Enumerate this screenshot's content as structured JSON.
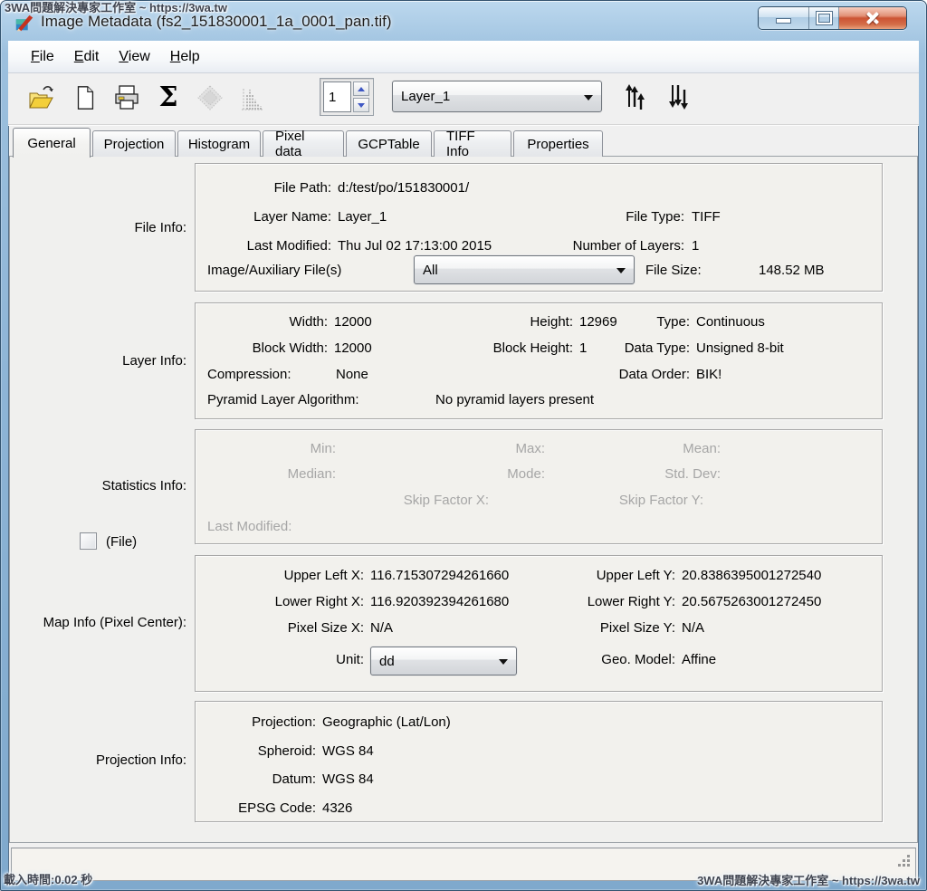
{
  "colors": {
    "frame_blue": "#8fb5d6",
    "close_button_red": "#cc5334",
    "dialog_bg": "#f0f0f0",
    "disabled_text": "#a6a6a6",
    "group_border": "#a7a7a7"
  },
  "watermarks": {
    "top_left": "3WA問題解決專家工作室 ~ https://3wa.tw",
    "bottom_left": "載入時間:0.02 秒",
    "bottom_right": "3WA問題解決專家工作室 ~ https://3wa.tw"
  },
  "window": {
    "title": "Image Metadata (fs2_151830001_1a_0001_pan.tif)",
    "controls": [
      "minimize",
      "maximize",
      "close"
    ]
  },
  "menu": {
    "items": [
      {
        "accel": "F",
        "rest": "ile"
      },
      {
        "accel": "E",
        "rest": "dit"
      },
      {
        "accel": "V",
        "rest": "iew"
      },
      {
        "accel": "H",
        "rest": "elp"
      }
    ]
  },
  "toolbar": {
    "icons": [
      "open-icon",
      "new-document-icon",
      "print-icon",
      "sum-icon",
      "pyramid-layers-icon",
      "histogram-icon",
      "layer-up-icon",
      "layer-down-icon"
    ],
    "sigma_glyph": "Σ",
    "layer_number": "1",
    "layer_combo_value": "Layer_1"
  },
  "tabs": {
    "active": "General",
    "items": [
      {
        "label": "General"
      },
      {
        "label": "Projection"
      },
      {
        "label": "Histogram"
      },
      {
        "label": "Pixel data"
      },
      {
        "label": "GCPTable"
      },
      {
        "label": "TIFF Info"
      },
      {
        "label": "Properties"
      }
    ]
  },
  "file_info": {
    "section_label": "File Info:",
    "file_path_label": "File Path:",
    "file_path_value": "d:/test/po/151830001/",
    "layer_name_label": "Layer Name:",
    "layer_name_value": "Layer_1",
    "file_type_label": "File Type:",
    "file_type_value": "TIFF",
    "last_modified_label": "Last Modified:",
    "last_modified_value": "Thu Jul 02 17:13:00 2015",
    "number_of_layers_label": "Number of Layers:",
    "number_of_layers_value": "1",
    "aux_files_label": "Image/Auxiliary File(s)",
    "aux_files_combo_value": "All",
    "file_size_label": "File Size:",
    "file_size_value": "148.52 MB"
  },
  "layer_info": {
    "section_label": "Layer Info:",
    "width_label": "Width:",
    "width_value": "12000",
    "height_label": "Height:",
    "height_value": "12969",
    "type_label": "Type:",
    "type_value": "Continuous",
    "block_width_label": "Block Width:",
    "block_width_value": "12000",
    "block_height_label": "Block Height:",
    "block_height_value": "1",
    "data_type_label": "Data Type:",
    "data_type_value": "Unsigned 8-bit",
    "compression_label": "Compression:",
    "compression_value": "None",
    "data_order_label": "Data Order:",
    "data_order_value": "BIK!",
    "pyramid_label": "Pyramid Layer Algorithm:",
    "pyramid_value": "No pyramid layers present"
  },
  "statistics_info": {
    "section_label": "Statistics Info:",
    "file_checkbox_label": "(File)",
    "min_label": "Min:",
    "max_label": "Max:",
    "mean_label": "Mean:",
    "median_label": "Median:",
    "mode_label": "Mode:",
    "std_dev_label": "Std. Dev:",
    "skip_x_label": "Skip Factor X:",
    "skip_y_label": "Skip Factor Y:",
    "last_modified_label": "Last Modified:"
  },
  "map_info": {
    "section_label": "Map Info (Pixel Center):",
    "ulx_label": "Upper Left X:",
    "ulx_value": "116.715307294261660",
    "uly_label": "Upper Left Y:",
    "uly_value": "20.8386395001272540",
    "lrx_label": "Lower Right X:",
    "lrx_value": "116.920392394261680",
    "lry_label": "Lower Right Y:",
    "lry_value": "20.5675263001272450",
    "psx_label": "Pixel Size X:",
    "psx_value": "N/A",
    "psy_label": "Pixel Size Y:",
    "psy_value": "N/A",
    "unit_label": "Unit:",
    "unit_combo_value": "dd",
    "geo_model_label": "Geo. Model:",
    "geo_model_value": "Affine"
  },
  "projection_info": {
    "section_label": "Projection Info:",
    "projection_label": "Projection:",
    "projection_value": "Geographic (Lat/Lon)",
    "spheroid_label": "Spheroid:",
    "spheroid_value": "WGS 84",
    "datum_label": "Datum:",
    "datum_value": "WGS 84",
    "epsg_label": "EPSG Code:",
    "epsg_value": "4326"
  }
}
